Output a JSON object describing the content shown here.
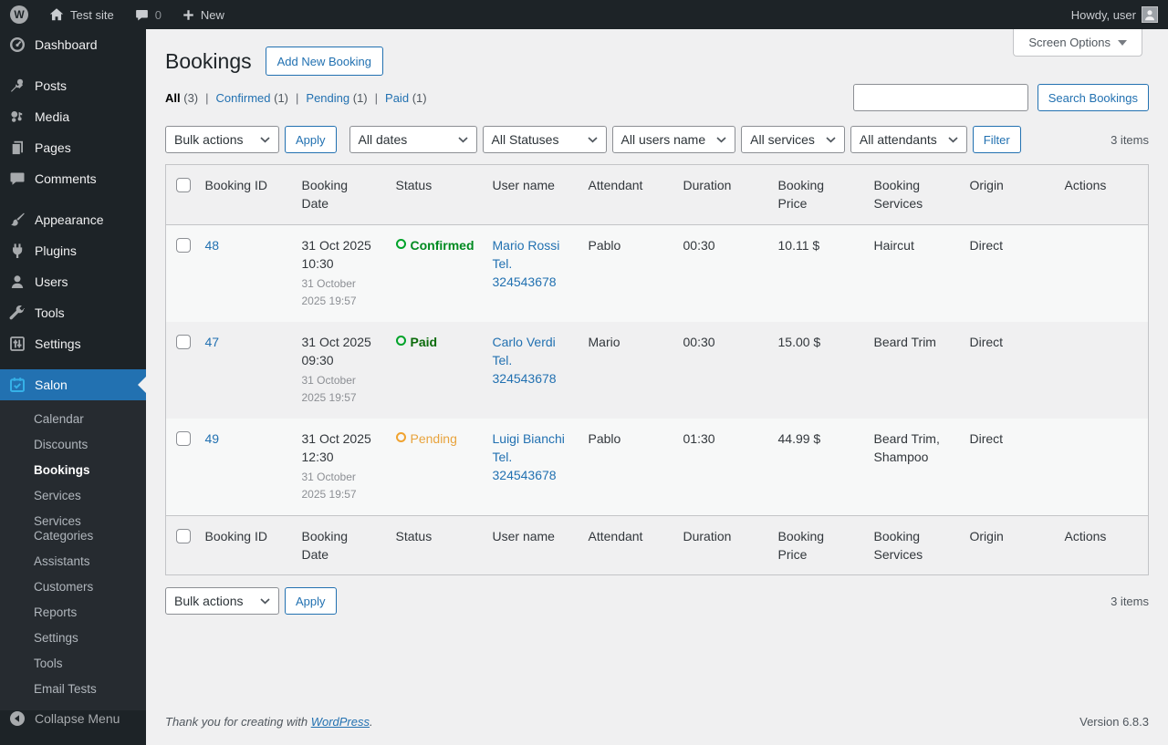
{
  "colors": {
    "accent_blue": "#2271b1",
    "admin_dark": "#1d2327",
    "content_bg": "#f0f0f1",
    "confirmed_green": "#008a20",
    "paid_green": "#0b6b0b",
    "pending_orange": "#e8a33d",
    "salon_icon_blue": "#35b1e8"
  },
  "admin_bar": {
    "site_name": "Test site",
    "comments_count": "0",
    "new_label": "New",
    "howdy": "Howdy, user"
  },
  "sidebar": {
    "items": [
      {
        "label": "Dashboard"
      },
      {
        "label": "Posts"
      },
      {
        "label": "Media"
      },
      {
        "label": "Pages"
      },
      {
        "label": "Comments"
      },
      {
        "label": "Appearance"
      },
      {
        "label": "Plugins"
      },
      {
        "label": "Users"
      },
      {
        "label": "Tools"
      },
      {
        "label": "Settings"
      },
      {
        "label": "Salon"
      }
    ],
    "submenu": [
      {
        "label": "Calendar"
      },
      {
        "label": "Discounts"
      },
      {
        "label": "Bookings"
      },
      {
        "label": "Services"
      },
      {
        "label": "Services Categories"
      },
      {
        "label": "Assistants"
      },
      {
        "label": "Customers"
      },
      {
        "label": "Reports"
      },
      {
        "label": "Settings"
      },
      {
        "label": "Tools"
      },
      {
        "label": "Email Tests"
      }
    ],
    "collapse_label": "Collapse Menu"
  },
  "header": {
    "title": "Bookings",
    "add_new_label": "Add New Booking",
    "screen_options_label": "Screen Options"
  },
  "filters": {
    "views": [
      {
        "label": "All",
        "count": "(3)"
      },
      {
        "label": "Confirmed",
        "count": "(1)"
      },
      {
        "label": "Pending",
        "count": "(1)"
      },
      {
        "label": "Paid",
        "count": "(1)"
      }
    ],
    "views_separator": "|",
    "search_value": "",
    "search_button_label": "Search Bookings",
    "bulk_actions_label": "Bulk actions",
    "apply_label": "Apply",
    "all_dates_label": "All dates",
    "all_statuses_label": "All Statuses",
    "all_users_label": "All users name",
    "all_services_label": "All services",
    "all_attendants_label": "All attendants",
    "filter_label": "Filter",
    "items_count": "3 items"
  },
  "table": {
    "columns": [
      "Booking ID",
      "Booking Date",
      "Status",
      "User name",
      "Attendant",
      "Duration",
      "Booking Price",
      "Booking Services",
      "Origin",
      "Actions"
    ],
    "rows": [
      {
        "id": "48",
        "date_main": "31 Oct 2025 10:30",
        "date_sub": "31 October 2025 19:57",
        "status": "Confirmed",
        "user": "Mario Rossi Tel. 324543678",
        "attendant": "Pablo",
        "duration": "00:30",
        "price": "10.11 $",
        "services": "Haircut",
        "origin": "Direct"
      },
      {
        "id": "47",
        "date_main": "31 Oct 2025 09:30",
        "date_sub": "31 October 2025 19:57",
        "status": "Paid",
        "user": "Carlo Verdi Tel. 324543678",
        "attendant": "Mario",
        "duration": "00:30",
        "price": "15.00 $",
        "services": "Beard Trim",
        "origin": "Direct"
      },
      {
        "id": "49",
        "date_main": "31 Oct 2025 12:30",
        "date_sub": "31 October 2025 19:57",
        "status": "Pending",
        "user": "Luigi Bianchi Tel. 324543678",
        "attendant": "Pablo",
        "duration": "01:30",
        "price": "44.99 $",
        "services": "Beard Trim, Shampoo",
        "origin": "Direct"
      }
    ]
  },
  "footer": {
    "thanks_prefix": "Thank you for creating with ",
    "wordpress_link": "WordPress",
    "thanks_suffix": ".",
    "version": "Version 6.8.3"
  }
}
